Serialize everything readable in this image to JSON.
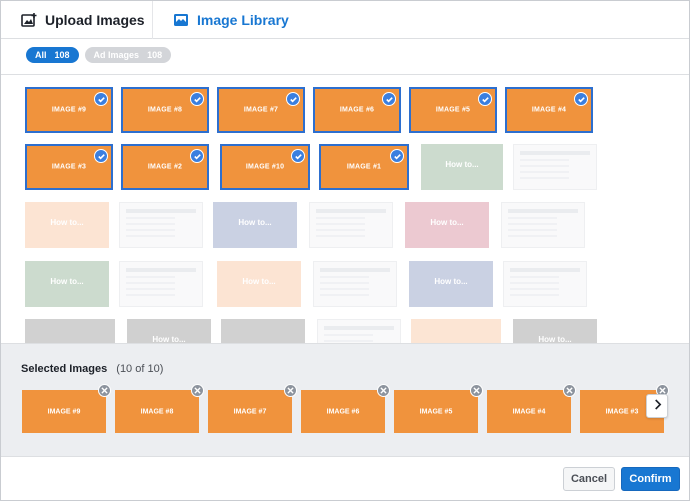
{
  "tabs": [
    {
      "label": "Upload Images",
      "active": false,
      "icon": "upload-image-icon"
    },
    {
      "label": "Image Library",
      "active": true,
      "icon": "image-library-icon"
    }
  ],
  "filters": {
    "all": {
      "label": "All",
      "count": "108"
    },
    "ad": {
      "label": "Ad Images",
      "count": "108"
    }
  },
  "grid": {
    "selected": [
      {
        "label": "IMAGE #9"
      },
      {
        "label": "IMAGE #8"
      },
      {
        "label": "IMAGE #7"
      },
      {
        "label": "IMAGE #6"
      },
      {
        "label": "IMAGE #5"
      },
      {
        "label": "IMAGE #4"
      },
      {
        "label": "IMAGE #3"
      },
      {
        "label": "IMAGE #2"
      },
      {
        "label": "IMAGE #10"
      },
      {
        "label": "IMAGE #1"
      }
    ],
    "unselected_text": {
      "how_to": "How to..."
    }
  },
  "tray": {
    "title": "Selected Images",
    "count": "(10 of 10)",
    "items": [
      {
        "label": "IMAGE #9"
      },
      {
        "label": "IMAGE #8"
      },
      {
        "label": "IMAGE #7"
      },
      {
        "label": "IMAGE #6"
      },
      {
        "label": "IMAGE #5"
      },
      {
        "label": "IMAGE #4"
      },
      {
        "label": "IMAGE #3"
      }
    ]
  },
  "footer": {
    "cancel": "Cancel",
    "confirm": "Confirm"
  },
  "colors": {
    "accent": "#1877d2",
    "selected_fill": "#f0933d",
    "selected_border": "#2d6fcf"
  }
}
